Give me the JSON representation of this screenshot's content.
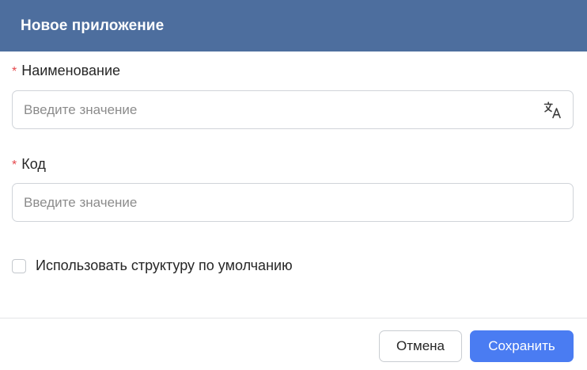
{
  "dialog": {
    "title": "Новое приложение"
  },
  "fields": {
    "name": {
      "required_mark": "*",
      "label": "Наименование",
      "value": "",
      "placeholder": "Введите значение",
      "translate_icon": "translate-icon"
    },
    "code": {
      "required_mark": "*",
      "label": "Код",
      "value": "",
      "placeholder": "Введите значение"
    }
  },
  "checkbox": {
    "label": "Использовать структуру по умолчанию",
    "checked": false
  },
  "footer": {
    "cancel_label": "Отмена",
    "save_label": "Сохранить"
  },
  "colors": {
    "header": "#4d6e9e",
    "primary": "#4a7cf2",
    "required": "#e5484d"
  }
}
